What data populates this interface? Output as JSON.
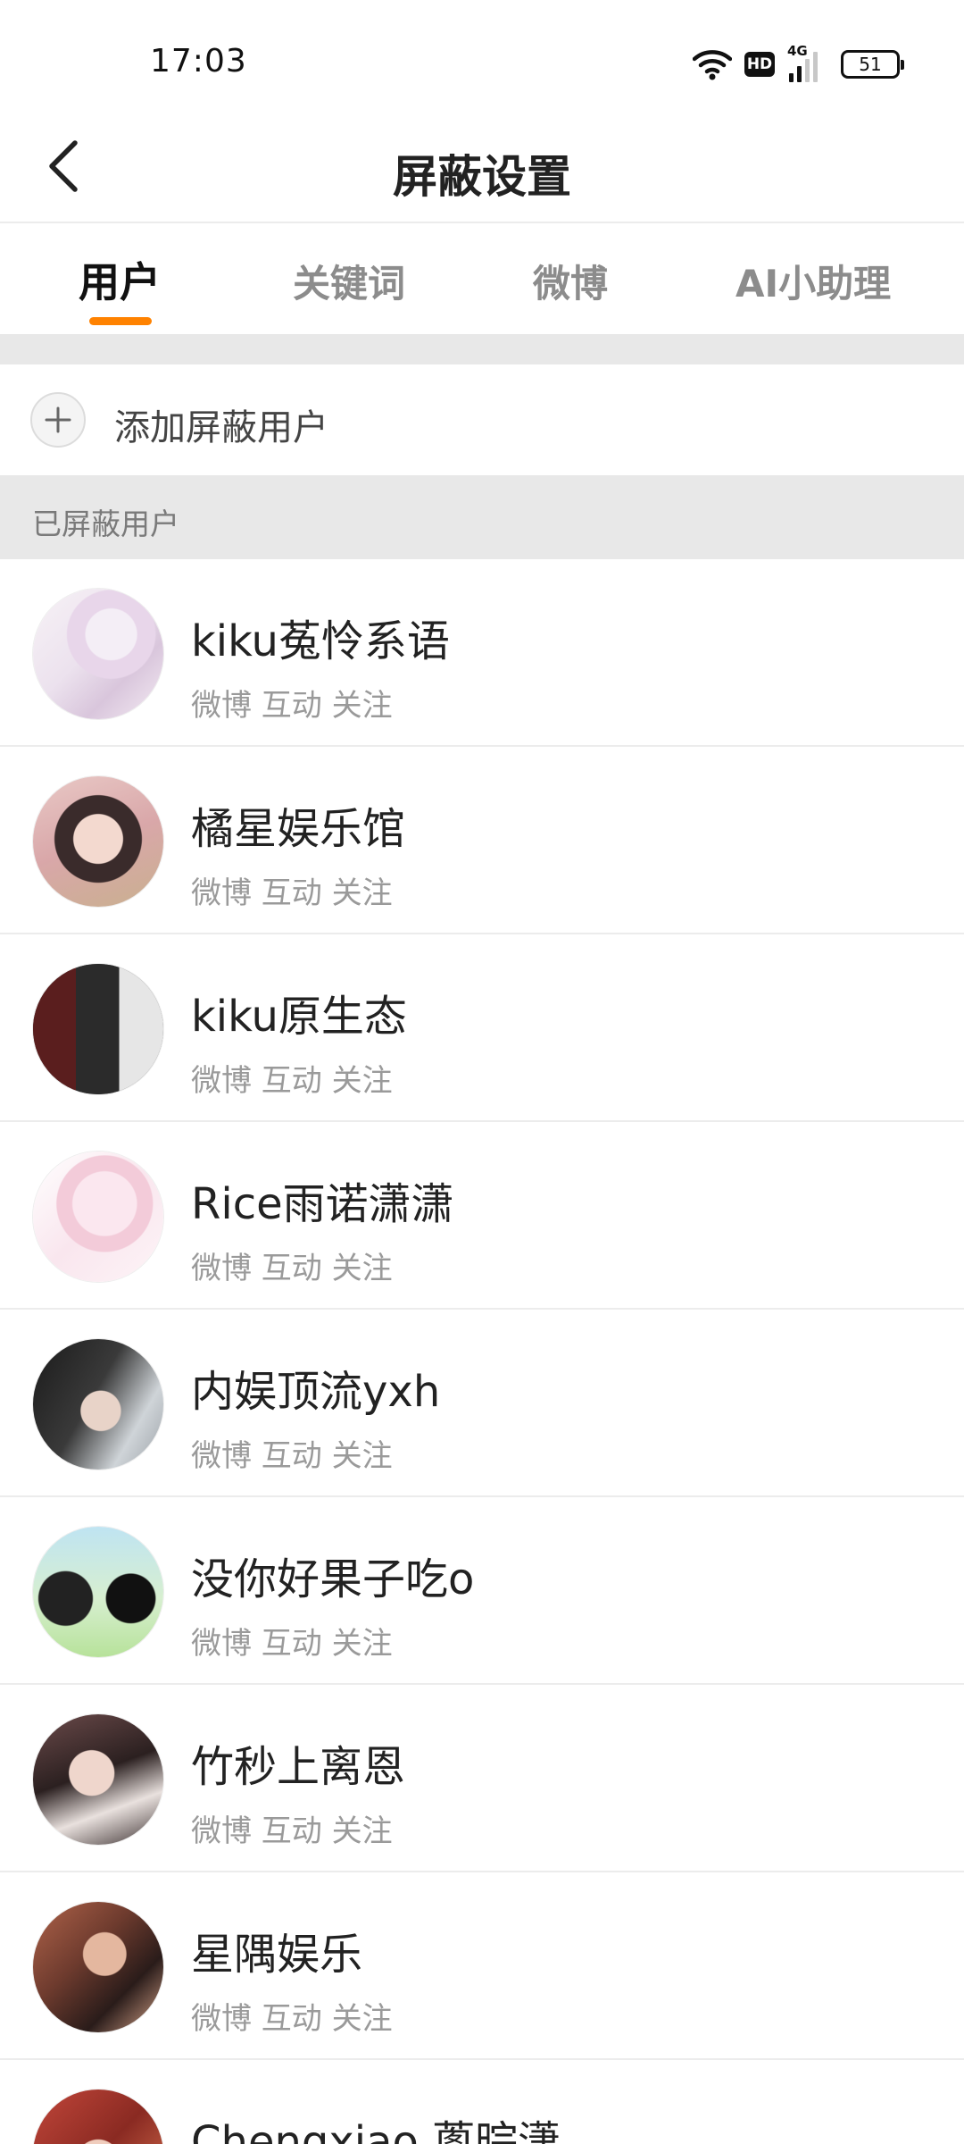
{
  "status_bar": {
    "time": "17:03",
    "hd_label": "HD",
    "network_label": "4G",
    "battery_level": "51",
    "icons": [
      "wifi-icon",
      "hd-icon",
      "signal-icon",
      "battery-icon"
    ]
  },
  "nav": {
    "title": "屏蔽设置",
    "back_icon": "chevron-left-icon"
  },
  "tabs": [
    {
      "label": "用户",
      "active": true
    },
    {
      "label": "关键词",
      "active": false
    },
    {
      "label": "微博",
      "active": false
    },
    {
      "label": "AI小助理",
      "active": false
    }
  ],
  "accent_color": "#ff8200",
  "add_row": {
    "icon": "plus-icon",
    "label": "添加屏蔽用户"
  },
  "section": {
    "title": "已屏蔽用户"
  },
  "users": [
    {
      "name": "kiku菟怜系语",
      "meta": "微博 互动 关注"
    },
    {
      "name": "橘星娱乐馆",
      "meta": "微博 互动 关注"
    },
    {
      "name": "kiku原生态",
      "meta": "微博 互动 关注"
    },
    {
      "name": "Rice雨诺潇潇",
      "meta": "微博 互动 关注"
    },
    {
      "name": "内娱顶流yxh",
      "meta": "微博 互动 关注"
    },
    {
      "name": "没你好果子吃o",
      "meta": "微博 互动 关注"
    },
    {
      "name": "竹秒上离恩",
      "meta": "微博 互动 关注"
    },
    {
      "name": "星隅娱乐",
      "meta": "微博 互动 关注"
    },
    {
      "name": "Chengxiao 蔥晥潇",
      "meta": ""
    }
  ]
}
